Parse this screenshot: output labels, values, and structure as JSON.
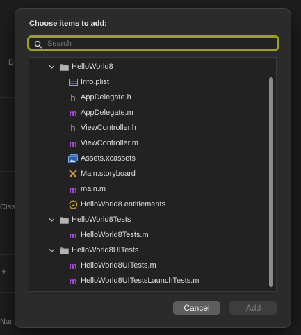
{
  "background": {
    "labels": [
      {
        "id": "d",
        "text": "D"
      },
      {
        "id": "clas",
        "text": "Clas"
      },
      {
        "id": "plus",
        "text": "+"
      },
      {
        "id": "nam",
        "text": "Nam"
      }
    ]
  },
  "dialog": {
    "title": "Choose items to add:",
    "search_placeholder": "Search",
    "cancel_label": "Cancel",
    "add_label": "Add",
    "accent_color": "#9c9e2a"
  },
  "tree": [
    {
      "label": "HelloWorld8",
      "kind": "folder",
      "expanded": true,
      "level": 0,
      "icon": "folder-icon"
    },
    {
      "label": "Info.plist",
      "kind": "plist",
      "level": 1,
      "icon": "plist-icon"
    },
    {
      "label": "AppDelegate.h",
      "kind": "h",
      "level": 1,
      "icon": "header-file-icon"
    },
    {
      "label": "AppDelegate.m",
      "kind": "m",
      "level": 1,
      "icon": "objc-file-icon"
    },
    {
      "label": "ViewController.h",
      "kind": "h",
      "level": 1,
      "icon": "header-file-icon"
    },
    {
      "label": "ViewController.m",
      "kind": "m",
      "level": 1,
      "icon": "objc-file-icon"
    },
    {
      "label": "Assets.xcassets",
      "kind": "assets",
      "level": 1,
      "icon": "asset-catalog-icon"
    },
    {
      "label": "Main.storyboard",
      "kind": "storyboard",
      "level": 1,
      "icon": "storyboard-icon"
    },
    {
      "label": "main.m",
      "kind": "m",
      "level": 1,
      "icon": "objc-file-icon"
    },
    {
      "label": "HelloWorld8.entitlements",
      "kind": "entitlements",
      "level": 1,
      "icon": "entitlements-icon"
    },
    {
      "label": "HelloWorld8Tests",
      "kind": "folder",
      "expanded": true,
      "level": 0,
      "icon": "folder-icon"
    },
    {
      "label": "HelloWorld8Tests.m",
      "kind": "m",
      "level": 1,
      "icon": "objc-file-icon"
    },
    {
      "label": "HelloWorld8UITests",
      "kind": "folder",
      "expanded": true,
      "level": 0,
      "icon": "folder-icon"
    },
    {
      "label": "HelloWorld8UITests.m",
      "kind": "m",
      "level": 1,
      "icon": "objc-file-icon"
    },
    {
      "label": "HelloWorld8UITestsLaunchTests.m",
      "kind": "m",
      "level": 1,
      "icon": "objc-file-icon"
    }
  ]
}
